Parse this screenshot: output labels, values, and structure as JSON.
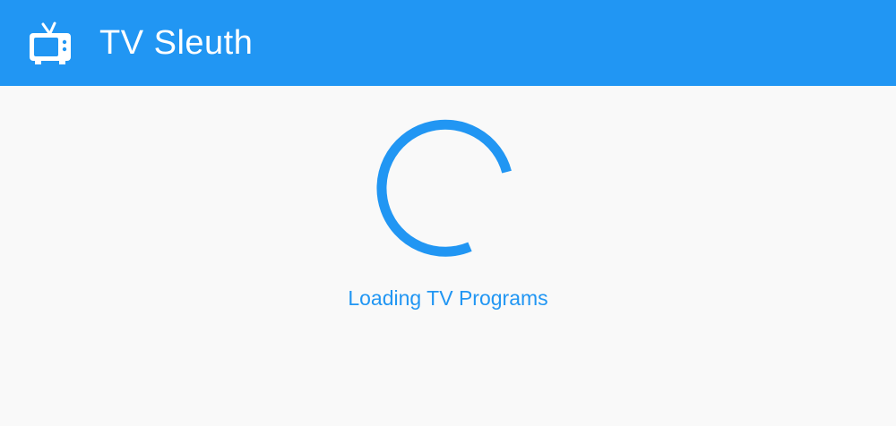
{
  "header": {
    "title": "TV Sleuth",
    "icon": "tv-icon",
    "background_color": "#2196f3",
    "text_color": "#ffffff"
  },
  "main": {
    "spinner_icon": "loading-spinner-icon",
    "spinner_color": "#2196f3",
    "loading_text": "Loading TV Programs"
  },
  "colors": {
    "page_background": "#f9f9f9",
    "accent": "#2196f3"
  }
}
